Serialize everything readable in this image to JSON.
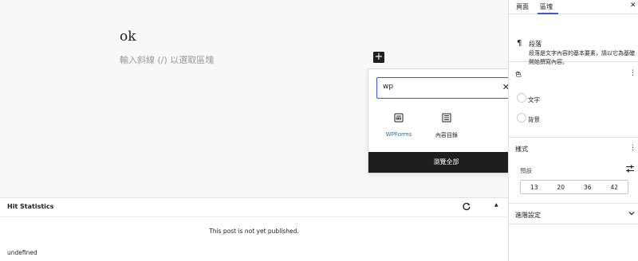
{
  "editor": {
    "post_title": "ok",
    "placeholder": "輸入斜線 (/) 以選取區塊",
    "inserter_symbol": "+"
  },
  "inserter": {
    "search_value": "wp",
    "clear_symbol": "✕",
    "results": [
      {
        "label": "WPForms",
        "icon": "wpforms-icon"
      },
      {
        "label": "內容目錄",
        "icon": "table-of-contents-icon"
      }
    ],
    "browse_all_label": "瀏覽全部"
  },
  "metabox": {
    "title": "Hit Statistics",
    "collapse_symbol": "▲",
    "status_text": "This post is not yet published.",
    "footer_text": "undefined"
  },
  "sidebar": {
    "tabs": [
      "頁面",
      "區塊"
    ],
    "active_tab": "區塊",
    "close_symbol": "✕",
    "block_card": {
      "icon_symbol": "¶",
      "title": "段落",
      "description": "段落是文字內容的基本要素，請以它為基礎開始撰寫內容。"
    },
    "color_panel": {
      "title": "色",
      "options": [
        "文字",
        "背景"
      ]
    },
    "typography_panel": {
      "title": "樣式",
      "size_label": "預設",
      "font_sizes": [
        "13",
        "20",
        "36",
        "42"
      ]
    },
    "advanced_panel": {
      "title": "進階設定"
    }
  },
  "colors": {
    "accent": "#3858e9",
    "link": "#2271b1",
    "dark": "#1e1e1e"
  }
}
